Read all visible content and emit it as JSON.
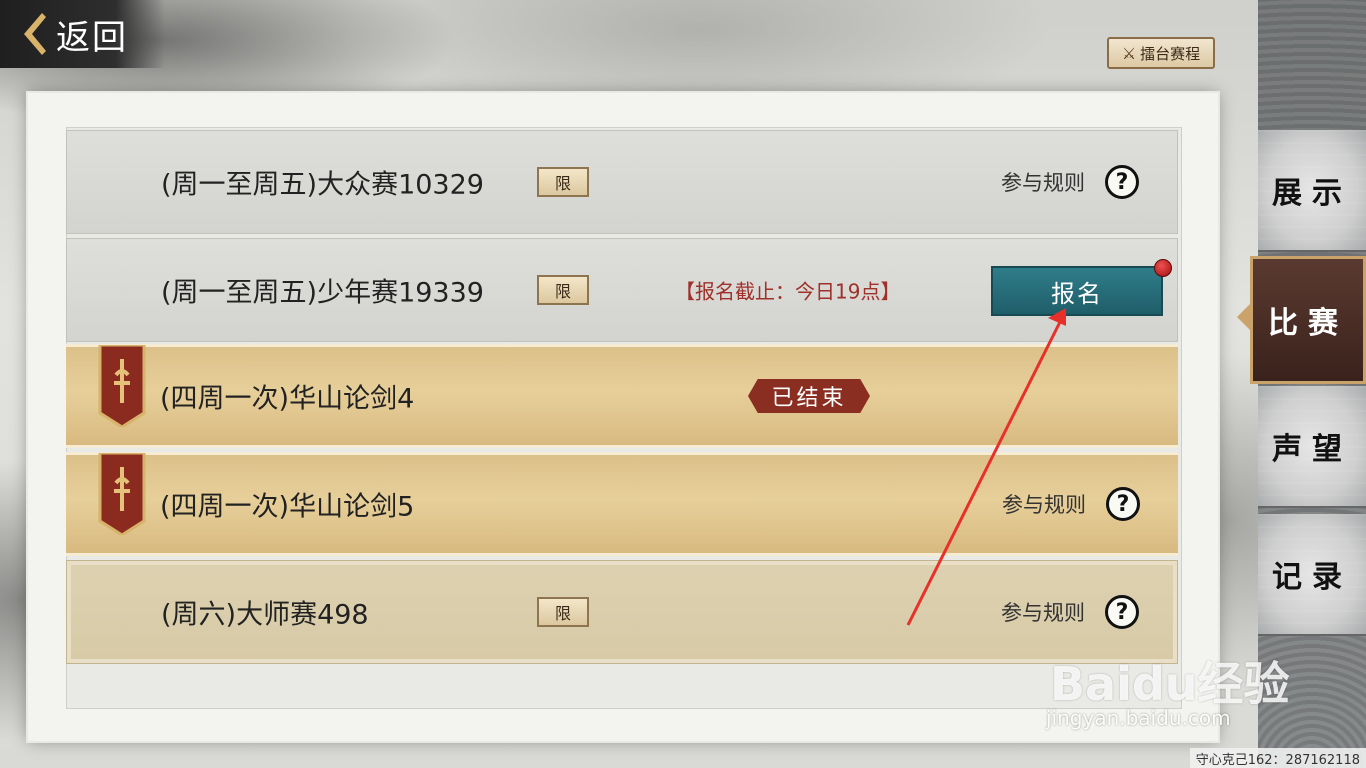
{
  "header": {
    "back_label": "返回",
    "schedule_label": "擂台赛程"
  },
  "rows": [
    {
      "title": "(周一至周五)大众赛10329",
      "badge": "限",
      "rules": "参与规则",
      "help": "?"
    },
    {
      "title": "(周一至周五)少年赛19339",
      "badge": "限",
      "deadline": "【报名截止：今日19点】",
      "signup": "报名"
    },
    {
      "title": "(四周一次)华山论剑4",
      "status": "已结束"
    },
    {
      "title": "(四周一次)华山论剑5",
      "rules": "参与规则",
      "help": "?"
    },
    {
      "title": "(周六)大师赛498",
      "badge": "限",
      "rules": "参与规则",
      "help": "?"
    }
  ],
  "sidebar": {
    "tabs": [
      {
        "label": "展示"
      },
      {
        "label": "比赛",
        "active": true
      },
      {
        "label": "声望"
      },
      {
        "label": "记录"
      }
    ]
  },
  "footer": {
    "player_info": "守心克己162：287162118"
  },
  "watermark": {
    "brand": "Baidu经验",
    "url": "jingyan.baidu.com"
  },
  "colors": {
    "signup": "#1f5e69",
    "ended_badge": "#8a2e22",
    "deadline": "#a0302a",
    "active_tab": "#3a221c"
  }
}
